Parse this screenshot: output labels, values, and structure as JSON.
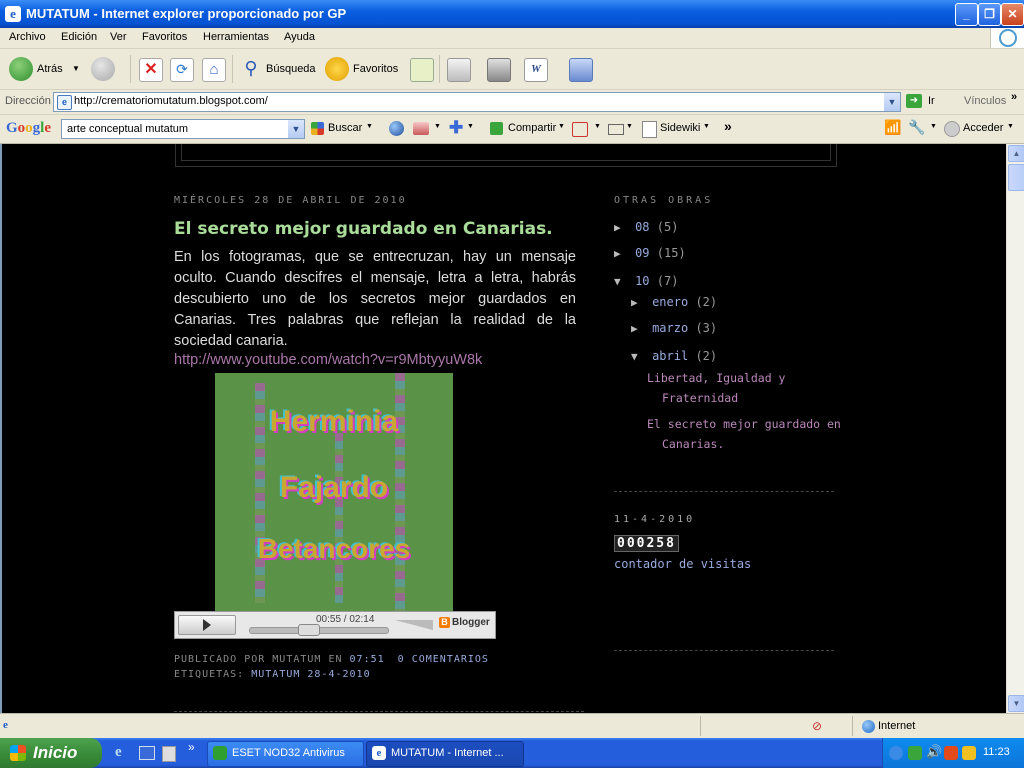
{
  "window": {
    "title": "MUTATUM - Internet explorer proporcionado por GP",
    "min": "_",
    "max": "❐",
    "close": "✕"
  },
  "menu": [
    "Archivo",
    "Edición",
    "Ver",
    "Favoritos",
    "Herramientas",
    "Ayuda"
  ],
  "toolbar": {
    "back": "Atrás",
    "search": "Búsqueda",
    "favorites": "Favoritos"
  },
  "address": {
    "label": "Dirección",
    "url": "http://crematoriomutatum.blogspot.com/",
    "go": "Ir",
    "links": "Vínculos"
  },
  "google": {
    "logo": "Google",
    "query": "arte conceptual mutatum",
    "buscar": "Buscar",
    "compartir": "Compartir",
    "sidewiki": "Sidewiki",
    "acceder": "Acceder"
  },
  "post": {
    "date": "MIÉRCOLES 28 DE ABRIL DE 2010",
    "title": "El secreto mejor guardado en Canarias.",
    "body": "En los fotogramas, que se entrecruzan, hay un mensaje oculto. Cuando descifres el mensaje, letra a letra, habrás descubierto uno de los secretos mejor guardados en Canarias. Tres palabras que reflejan la realidad de la sociedad canaria.",
    "link": "http://www.youtube.com/watch?v=r9MbtyyuW8k",
    "video_lines": [
      "Herminia",
      "Fajardo",
      "Betancores"
    ],
    "player_time": "00:55 / 02:14",
    "player_progress": 0.41,
    "blogger": "Blogger",
    "published_by": "PUBLICADO POR MUTATUM EN",
    "time": "07:51",
    "comments": "0 COMENTARIOS",
    "labels_label": "ETIQUETAS:",
    "labels": "MUTATUM 28-4-2010"
  },
  "sidebar": {
    "title": "OTRAS OBRAS",
    "archive": [
      {
        "label": "08",
        "count": "(5)"
      },
      {
        "label": "09",
        "count": "(15)"
      },
      {
        "label": "10",
        "count": "(7)"
      }
    ],
    "months": [
      {
        "label": "enero",
        "count": "(2)"
      },
      {
        "label": "marzo",
        "count": "(3)"
      },
      {
        "label": "abril",
        "count": "(2)"
      }
    ],
    "posts": [
      "Libertad, Igualdad y Fraternidad",
      "El secreto mejor guardado en Canarias."
    ],
    "date2": "11-4-2010",
    "counter": "000258",
    "counter_label": "contador de visitas"
  },
  "status": {
    "zone": "Internet"
  },
  "taskbar": {
    "start": "Inicio",
    "tasks": [
      "ESET NOD32 Antivirus",
      "MUTATUM - Internet ..."
    ],
    "clock": "11:23"
  },
  "colors": {
    "title_green": "#aadd99",
    "link_purple": "#aa77aa",
    "archive_blue": "#99aadd"
  }
}
